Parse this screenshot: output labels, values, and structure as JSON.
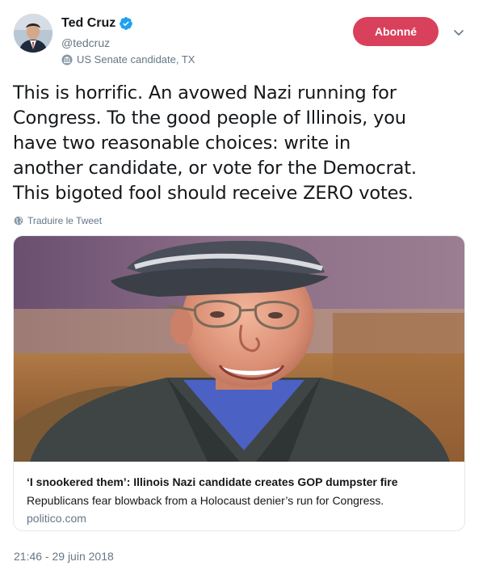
{
  "user": {
    "name": "Ted Cruz",
    "handle": "@tedcruz",
    "label": "US Senate candidate, TX"
  },
  "follow_button": "Abonné",
  "tweet_text": "This is horrific. An avowed Nazi running for\nCongress. To the good people of Illinois, you\nhave two reasonable choices:  write in\nanother candidate, or vote for the Democrat.\nThis bigoted fool should receive ZERO votes.",
  "translate_label": "Traduire le Tweet",
  "card": {
    "title": "‘I snookered them’: Illinois Nazi candidate creates GOP dumpster fire",
    "description": "Republicans fear blowback from a Holocaust denier’s run for Congress.",
    "domain": "politico.com"
  },
  "timestamp": "21:46 - 29 juin 2018",
  "colors": {
    "follow_button_bg": "#d9405b",
    "verified_badge": "#1da1f2",
    "secondary_text": "#657786"
  }
}
